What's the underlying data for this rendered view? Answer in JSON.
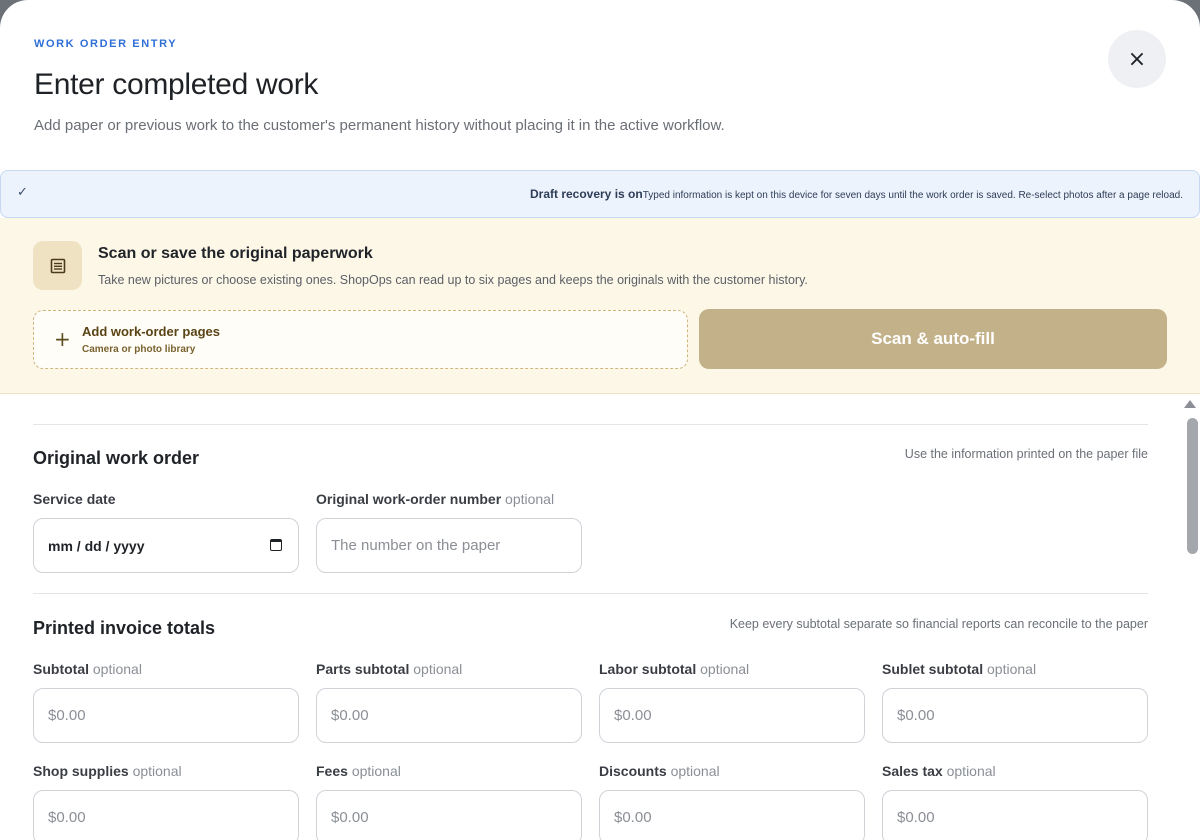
{
  "header": {
    "eyebrow": "WORK ORDER ENTRY",
    "title": "Enter completed work",
    "subtitle": "Add paper or previous work to the customer's permanent history without placing it in the active workflow.",
    "close_label": "×"
  },
  "banner": {
    "check": "✓",
    "strong": "Draft recovery is on",
    "text": "Typed information is kept on this device for seven days until the work order is saved. Re-select photos after a page reload."
  },
  "scan": {
    "icon": "document-icon",
    "title": "Scan or save the original paperwork",
    "description": "Take new pictures or choose existing ones. ShopOps can read up to six pages and keeps the originals with the customer history.",
    "add_plus": "+",
    "add_title": "Add work-order pages",
    "add_sub": "Camera or photo library",
    "scan_button": "Scan & auto-fill"
  },
  "original": {
    "title": "Original work order",
    "note": "Use the information printed on the paper file",
    "service_date_label": "Service date",
    "service_date_value": "mm / dd / yyyy",
    "number_label": "Original work-order number",
    "number_optional": "optional",
    "number_placeholder": "The number on the paper"
  },
  "totals": {
    "title": "Printed invoice totals",
    "note": "Keep every subtotal separate so financial reports can reconcile to the paper",
    "optional": "optional",
    "fields": [
      {
        "label": "Subtotal",
        "placeholder": "$0.00"
      },
      {
        "label": "Parts subtotal",
        "placeholder": "$0.00"
      },
      {
        "label": "Labor subtotal",
        "placeholder": "$0.00"
      },
      {
        "label": "Sublet subtotal",
        "placeholder": "$0.00"
      },
      {
        "label": "Shop supplies",
        "placeholder": "$0.00"
      },
      {
        "label": "Fees",
        "placeholder": "$0.00"
      },
      {
        "label": "Discounts",
        "placeholder": "$0.00"
      },
      {
        "label": "Sales tax",
        "placeholder": "$0.00"
      }
    ]
  }
}
